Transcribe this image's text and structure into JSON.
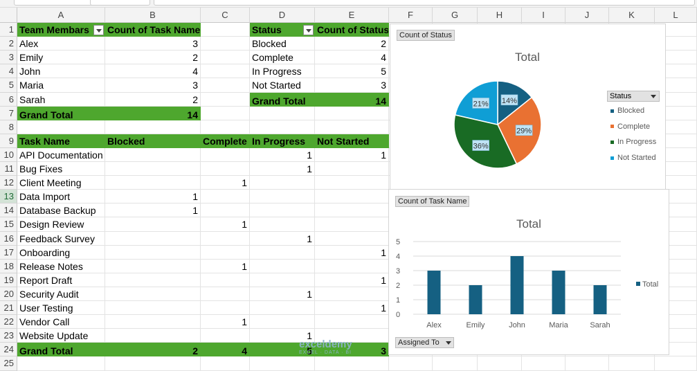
{
  "columns": [
    "A",
    "B",
    "C",
    "D",
    "E",
    "F",
    "G",
    "H",
    "I",
    "J",
    "K",
    "L"
  ],
  "rows": [
    "1",
    "2",
    "3",
    "4",
    "5",
    "6",
    "7",
    "8",
    "9",
    "10",
    "11",
    "12",
    "13",
    "14",
    "15",
    "16",
    "17",
    "18",
    "19",
    "20",
    "21",
    "22",
    "23",
    "24",
    "25"
  ],
  "pivot1": {
    "header": [
      "Team Membars",
      "Count of Task Name"
    ],
    "rows": [
      [
        "Alex",
        "3"
      ],
      [
        "Emily",
        "2"
      ],
      [
        "John",
        "4"
      ],
      [
        "Maria",
        "3"
      ],
      [
        "Sarah",
        "2"
      ]
    ],
    "grand_total": [
      "Grand Total",
      "14"
    ]
  },
  "pivot2": {
    "header": [
      "Status",
      "Count of Status"
    ],
    "rows": [
      [
        "Blocked",
        "2"
      ],
      [
        "Complete",
        "4"
      ],
      [
        "In Progress",
        "5"
      ],
      [
        "Not Started",
        "3"
      ]
    ],
    "grand_total": [
      "Grand Total",
      "14"
    ]
  },
  "pivot3": {
    "header": [
      "Task Name",
      "Blocked",
      "Complete",
      "In Progress",
      "Not Started"
    ],
    "rows": [
      [
        "API Documentation",
        "",
        "",
        "1",
        "1"
      ],
      [
        "Bug Fixes",
        "",
        "",
        "1",
        ""
      ],
      [
        "Client Meeting",
        "",
        "1",
        "",
        ""
      ],
      [
        "Data Import",
        "1",
        "",
        "",
        ""
      ],
      [
        "Database Backup",
        "1",
        "",
        "",
        ""
      ],
      [
        "Design Review",
        "",
        "1",
        "",
        ""
      ],
      [
        "Feedback Survey",
        "",
        "",
        "1",
        ""
      ],
      [
        "Onboarding",
        "",
        "",
        "",
        "1"
      ],
      [
        "Release Notes",
        "",
        "1",
        "",
        ""
      ],
      [
        "Report Draft",
        "",
        "",
        "",
        "1"
      ],
      [
        "Security Audit",
        "",
        "",
        "1",
        ""
      ],
      [
        "User Testing",
        "",
        "",
        "",
        "1"
      ],
      [
        "Vendor Call",
        "",
        "1",
        "",
        ""
      ],
      [
        "Website Update",
        "",
        "",
        "1",
        ""
      ]
    ],
    "grand_total": [
      "Grand Total",
      "2",
      "4",
      "5",
      "3"
    ]
  },
  "pie_chart": {
    "chip": "Count of Status",
    "legend_title": "Status",
    "chart_data": {
      "type": "pie",
      "title": "Total",
      "categories": [
        "Blocked",
        "Complete",
        "In Progress",
        "Not Started"
      ],
      "values": [
        2,
        4,
        5,
        3
      ],
      "labels": [
        "14%",
        "29%",
        "36%",
        "21%"
      ],
      "colors": [
        "#156082",
        "#e97132",
        "#196b24",
        "#0f9ed5"
      ],
      "legend": "right"
    }
  },
  "bar_chart": {
    "chip": "Count of Task Name",
    "filter_chip": "Assigned To",
    "chart_data": {
      "type": "bar",
      "title": "Total",
      "categories": [
        "Alex",
        "Emily",
        "John",
        "Maria",
        "Sarah"
      ],
      "series": [
        {
          "name": "Total",
          "values": [
            3,
            2,
            4,
            3,
            2
          ]
        }
      ],
      "ylim": [
        0,
        5
      ],
      "yticks": [
        "0",
        "1",
        "2",
        "3",
        "4",
        "5"
      ],
      "color": "#156082",
      "grid": true,
      "legend": "right"
    }
  },
  "watermark": {
    "name": "exceldemy",
    "tagline": "EXCEL · DATA · BI"
  }
}
